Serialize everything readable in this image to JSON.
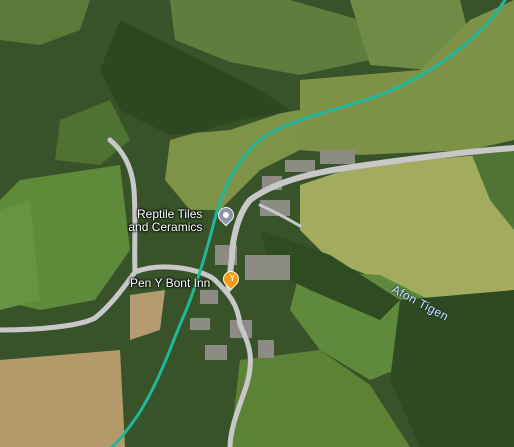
{
  "map": {
    "view": "satellite",
    "labels": {
      "reptile_poi_line1": "Reptile Tiles",
      "reptile_poi_line2": "and Ceramics",
      "pub_poi": "Pen Y Bont Inn",
      "river": "Afon Tigen"
    },
    "colors": {
      "route_line": "#1fb89a",
      "road": "#c8c8c8",
      "shop_pin": "#8a96a6",
      "pub_pin": "#f29d1a",
      "river_label": "#c9e6ff"
    },
    "icons": {
      "shop_pin": "map-pin-icon",
      "pub_pin": "goblet-pin-icon"
    }
  }
}
